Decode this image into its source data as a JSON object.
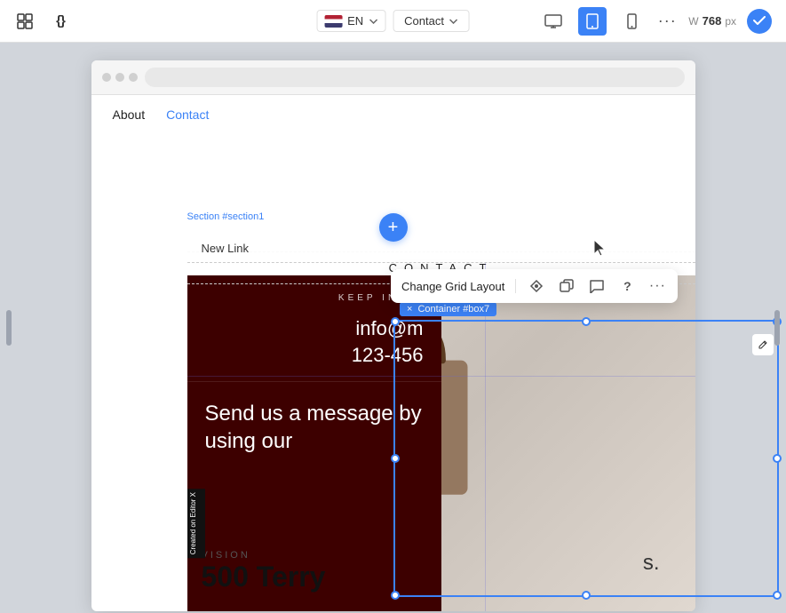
{
  "toolbar": {
    "language": "EN",
    "page": "Contact",
    "width_label": "W",
    "width_value": "768",
    "width_unit": "px",
    "icons": {
      "grid": "⊞",
      "code": "{}",
      "more": "···",
      "check": "✓",
      "desktop": "🖥",
      "tablet": "▣",
      "mobile": "📱"
    }
  },
  "browser": {
    "url_placeholder": ""
  },
  "site": {
    "nav_items": [
      "About",
      "Contact"
    ],
    "active_nav": "Contact"
  },
  "section": {
    "label": "Section #section1",
    "add_btn": "+",
    "new_link": "New Link",
    "contact_header": "CONTACT"
  },
  "floating_toolbar": {
    "label": "Change Grid Layout",
    "icons": {
      "diamond": "◈",
      "copy": "⧉",
      "comment": "💬",
      "help": "?",
      "more": "···"
    }
  },
  "container_label": "× Container #box7",
  "left_panel": {
    "vision_label": "VISION",
    "vision_number": "500 Terry",
    "logo": "s.",
    "badge": "Created on Editor X"
  },
  "right_panel": {
    "keep_in_touch": "KEEP IN TO",
    "email": "info@m",
    "phone": "123-456",
    "send_message": "Send us a message\nby using our"
  }
}
